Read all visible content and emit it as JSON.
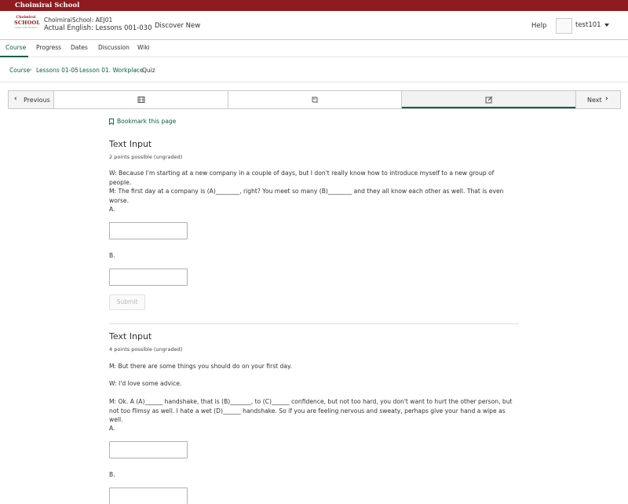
{
  "topbar": {
    "brand": "Choimirai School"
  },
  "header": {
    "logo_line1": "Choimirai",
    "logo_line2": "SCHOOL",
    "logo_line3": "Learn with Dreams",
    "course_org": "ChoimiraiSchool: AEJ01",
    "course_name": "Actual English: Lessons 001-030",
    "discover": "Discover New",
    "help": "Help",
    "username": "test101"
  },
  "tabs": [
    "Course",
    "Progress",
    "Dates",
    "Discussion",
    "Wiki"
  ],
  "breadcrumb": {
    "course": "Course",
    "section": "Lessons 01-05",
    "subsection": "Lesson 01. Workplace",
    "current": "Quiz"
  },
  "seqnav": {
    "previous": "Previous",
    "next": "Next"
  },
  "bookmark": "Bookmark this page",
  "problem1": {
    "title": "Text Input",
    "points": "2 points possible (ungraded)",
    "p1": "W: Because I'm starting at a new company in a couple of days, but I don't really know how to introduce myself to a new group of people.",
    "p2": "M: The first day at a company is (A)________, right? You meet so many (B)________ and they all know each other as well. That is even worse.",
    "label_a": "A.",
    "label_b": "B.",
    "submit": "Submit"
  },
  "problem2": {
    "title": "Text Input",
    "points": "4 points possible (ungraded)",
    "p1": "M: But there are some things you should do on your first day.",
    "p2": "W: I'd love some advice.",
    "p3": "M: Ok. A (A)______ handshake, that is (B)_______, to (C)______ confidence, but not too hard, you don't want to hurt the other person, but not too flimsy as well. I hate a wet (D)______ handshake. So if you are feeling nervous and sweaty, perhaps give your hand a wipe as well.",
    "label_a": "A.",
    "label_b": "B."
  },
  "colors": {
    "brand": "#8e1b1f",
    "accent": "#0a6048"
  }
}
